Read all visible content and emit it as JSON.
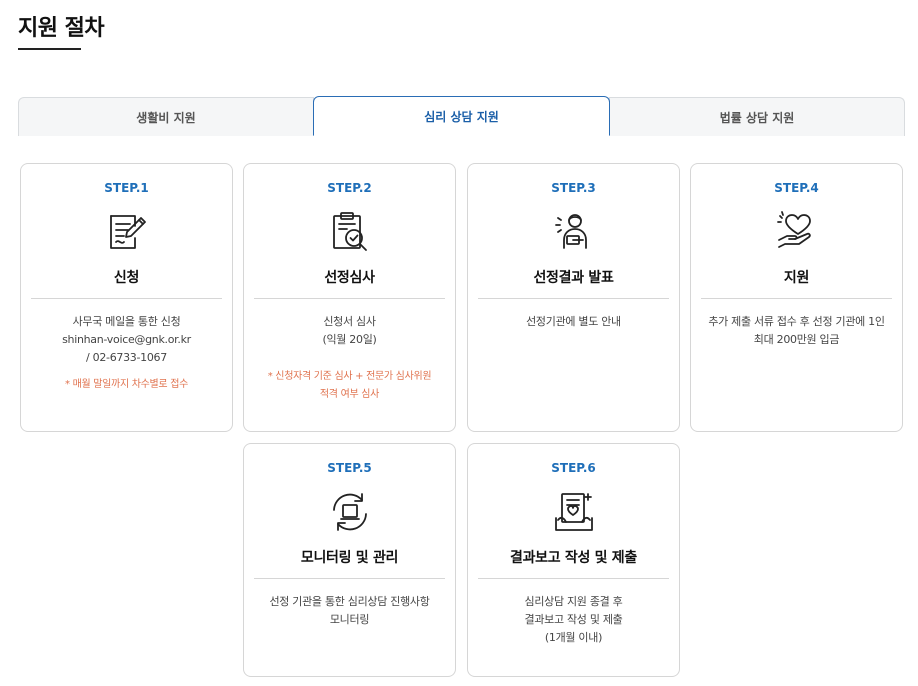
{
  "page_title": "지원 절차",
  "tabs": [
    {
      "label": "생활비 지원",
      "active": false
    },
    {
      "label": "심리 상담 지원",
      "active": true
    },
    {
      "label": "법률 상담 지원",
      "active": false
    }
  ],
  "colors": {
    "accent": "#1f6fb9",
    "note": "#e0734f",
    "border": "#d6d6d6"
  },
  "steps": [
    {
      "step": "STEP.1",
      "icon": "application-form-icon",
      "title": "신청",
      "lines": [
        "사무국 메일을 통한 신청",
        "shinhan-voice@gnk.or.kr",
        "/ 02-6733-1067"
      ],
      "note": [
        "* 매월 말일까지 차수별로 접수"
      ]
    },
    {
      "step": "STEP.2",
      "icon": "clipboard-review-icon",
      "title": "선정심사",
      "lines": [
        "신청서 심사",
        "(익월 20일)"
      ],
      "note": [
        "* 신청자격 기준 심사 + 전문가 심사위원",
        "적격 여부 심사"
      ]
    },
    {
      "step": "STEP.3",
      "icon": "announcement-person-icon",
      "title": "선정결과 발표",
      "lines": [
        "선정기관에 별도 안내"
      ]
    },
    {
      "step": "STEP.4",
      "icon": "heart-hand-icon",
      "title": "지원",
      "lines": [
        "추가 제출 서류 접수 후 선정 기관에 1인",
        "최대 200만원 입금"
      ]
    },
    {
      "step": "STEP.5",
      "icon": "monitoring-cycle-icon",
      "title": "모니터링 및 관리",
      "lines": [
        "선정 기관을 통한 심리상담 진행사항",
        "모니터링"
      ]
    },
    {
      "step": "STEP.6",
      "icon": "report-submit-icon",
      "title": "결과보고 작성 및 제출",
      "lines": [
        "심리상담 지원 종결 후",
        "결과보고 작성 및 제출",
        "(1개월 이내)"
      ]
    }
  ]
}
